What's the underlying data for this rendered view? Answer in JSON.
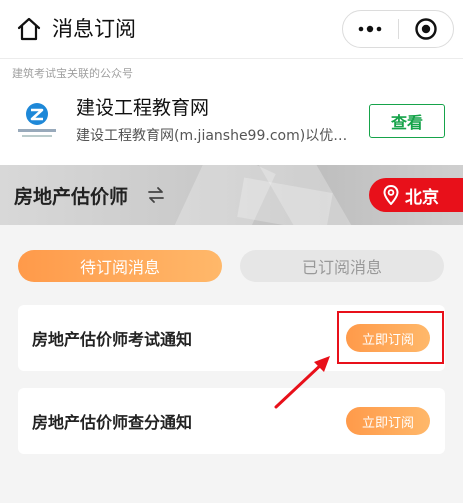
{
  "navbar": {
    "title": "消息订阅"
  },
  "official_account": {
    "header": "建筑考试宝关联的公众号",
    "name": "建设工程教育网",
    "description": "建设工程教育网(m.jianshe99.com)以优…",
    "view_button": "查看"
  },
  "banner": {
    "title": "房地产估价师",
    "city": "北京"
  },
  "tabs": [
    {
      "label": "待订阅消息",
      "active": true
    },
    {
      "label": "已订阅消息",
      "active": false
    }
  ],
  "notices": [
    {
      "label": "房地产估价师考试通知",
      "button": "立即订阅"
    },
    {
      "label": "房地产估价师查分通知",
      "button": "立即订阅"
    }
  ],
  "colors": {
    "accent_orange": "#ff9a4a",
    "wechat_green": "#16a34a",
    "highlight_red": "#e8101a"
  },
  "icons": [
    "home-icon",
    "more-dots-icon",
    "close-circle-icon",
    "swap-icon",
    "location-pin-icon",
    "arrow-icon"
  ]
}
